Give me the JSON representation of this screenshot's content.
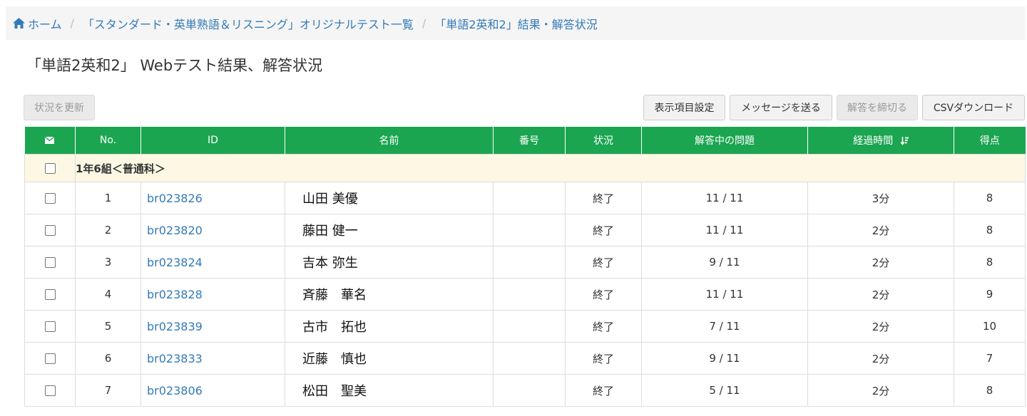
{
  "breadcrumb": {
    "home": "ホーム",
    "item1": "「スタンダード・英単熟語＆リスニング」オリジナルテスト一覧",
    "item2": "「単語2英和2」結果・解答状況"
  },
  "title": "「単語2英和2」 Webテスト結果、解答状況",
  "toolbar": {
    "refresh": "状況を更新",
    "display_settings": "表示項目設定",
    "send_message": "メッセージを送る",
    "close_answers": "解答を締切る",
    "csv_download": "CSVダウンロード"
  },
  "table": {
    "headers": [
      "No.",
      "ID",
      "名前",
      "番号",
      "状況",
      "解答中の問題",
      "経過時間",
      "得点"
    ],
    "group": "1年6組＜普通科＞",
    "rows": [
      {
        "no": "1",
        "id": "br023826",
        "name": "山田 美優",
        "number": "",
        "status": "終了",
        "question": "11 / 11",
        "time": "3分",
        "score": "8"
      },
      {
        "no": "2",
        "id": "br023820",
        "name": "藤田 健一",
        "number": "",
        "status": "終了",
        "question": "11 / 11",
        "time": "2分",
        "score": "8"
      },
      {
        "no": "3",
        "id": "br023824",
        "name": "吉本 弥生",
        "number": "",
        "status": "終了",
        "question": "9 / 11",
        "time": "2分",
        "score": "8"
      },
      {
        "no": "4",
        "id": "br023828",
        "name": "斉藤　華名",
        "number": "",
        "status": "終了",
        "question": "11 / 11",
        "time": "2分",
        "score": "9"
      },
      {
        "no": "5",
        "id": "br023839",
        "name": "古市　拓也",
        "number": "",
        "status": "終了",
        "question": "7 / 11",
        "time": "2分",
        "score": "10"
      },
      {
        "no": "6",
        "id": "br023833",
        "name": "近藤　慎也",
        "number": "",
        "status": "終了",
        "question": "9 / 11",
        "time": "2分",
        "score": "7"
      },
      {
        "no": "7",
        "id": "br023806",
        "name": "松田　聖美",
        "number": "",
        "status": "終了",
        "question": "5 / 11",
        "time": "2分",
        "score": "8"
      }
    ]
  },
  "colors": {
    "header_green": "#1ba551",
    "link_blue": "#337ab7",
    "group_row": "#fcf8e3"
  },
  "icons": {
    "home": "home-icon",
    "mail": "envelope-icon",
    "sort": "sort-desc-icon"
  }
}
